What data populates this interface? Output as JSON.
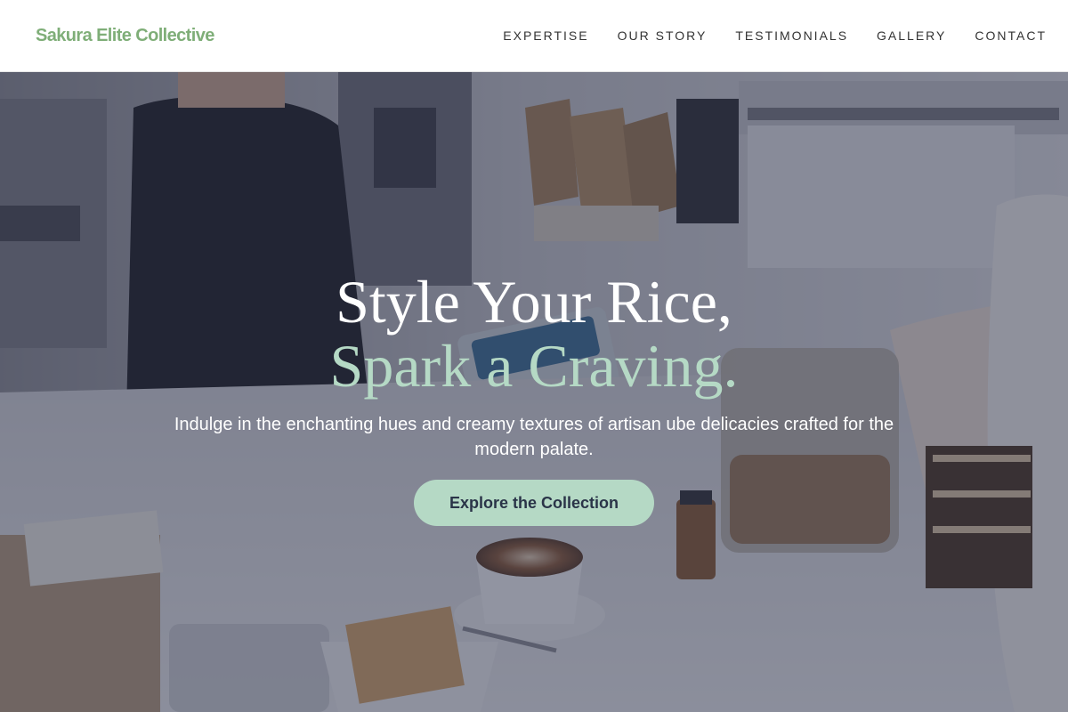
{
  "header": {
    "brand": "Sakura Elite Collective",
    "nav": [
      {
        "label": "EXPERTISE"
      },
      {
        "label": "OUR STORY"
      },
      {
        "label": "TESTIMONIALS"
      },
      {
        "label": "GALLERY"
      },
      {
        "label": "CONTACT"
      }
    ]
  },
  "hero": {
    "title_line1": "Style Your Rice,",
    "title_line2": "Spark a Craving.",
    "subtitle": "Indulge in the enchanting hues and creamy textures of artisan ube delicacies crafted for the modern palate.",
    "cta_label": "Explore the Collection",
    "background_scene": "cafe-counter-photo",
    "colors": {
      "brand_green": "#7fae78",
      "accent_mint": "#b5d9c5",
      "overlay": "#282e46",
      "cta_text": "#2a3448"
    }
  }
}
